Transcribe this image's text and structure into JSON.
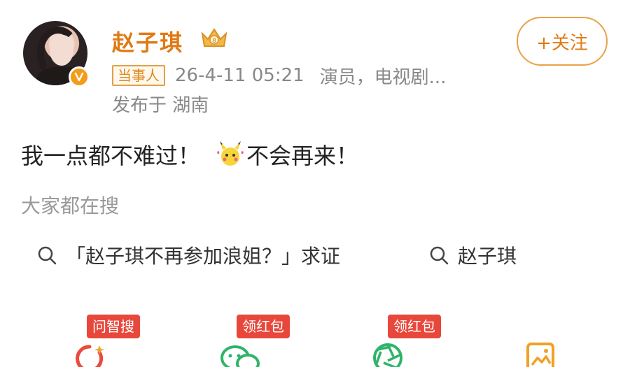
{
  "user": {
    "name": "赵子琪",
    "badge_label": "当事人",
    "timestamp": "26-4-11 05:21",
    "source": "演员，电视剧...",
    "location": "发布于 湖南",
    "follow_label": "+关注"
  },
  "post": {
    "text_before": "我一点都不难过！",
    "text_after": "不会再来！"
  },
  "search": {
    "heading": "大家都在搜",
    "chips": [
      "「赵子琪不再参加浪姐？」求证",
      "赵子琪"
    ]
  },
  "actions": [
    {
      "tag": "问智搜",
      "icon": "loading-ring-icon"
    },
    {
      "tag": "领红包",
      "icon": "wechat-icon"
    },
    {
      "tag": "领红包",
      "icon": "aperture-icon"
    },
    {
      "tag": "",
      "icon": "image-icon"
    }
  ],
  "colors": {
    "accent": "#e07a14",
    "tag_red": "#e8473b",
    "muted": "#888888"
  }
}
